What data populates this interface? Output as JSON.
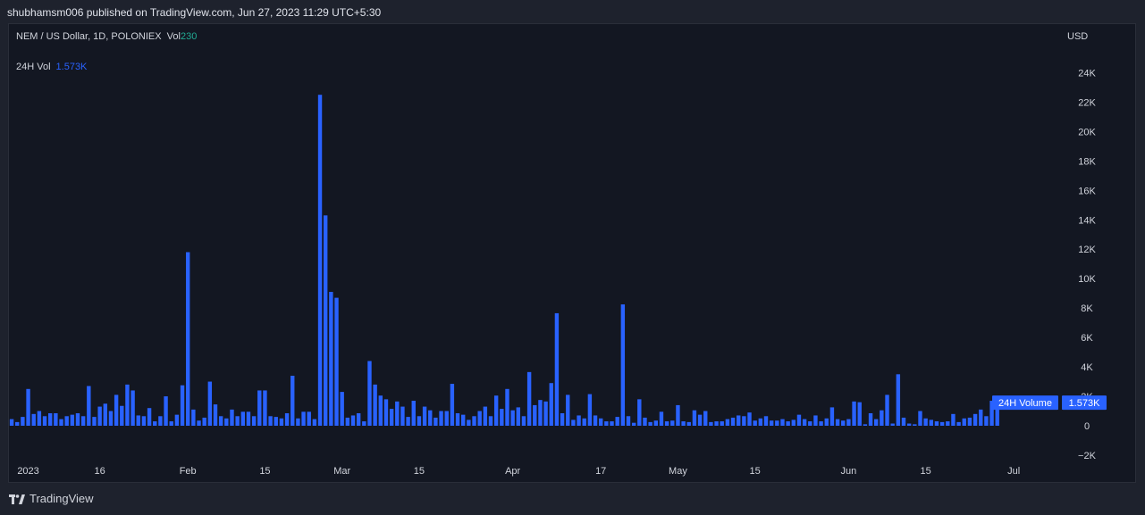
{
  "header": {
    "publish_line": "shubhamsm006 published on TradingView.com, Jun 27, 2023 11:29 UTC+5:30"
  },
  "legend": {
    "symbol": "NEM / US Dollar, 1D, POLONIEX",
    "vol_label": "Vol",
    "vol_value": "230",
    "indicator_label": "24H Vol",
    "indicator_value": "1.573K"
  },
  "currency": "USD",
  "footer": {
    "brand": "TradingView"
  },
  "chart_data": {
    "type": "bar",
    "ylim": [
      -2000,
      25000
    ],
    "yticks": [
      {
        "v": 24000,
        "label": "24K"
      },
      {
        "v": 22000,
        "label": "22K"
      },
      {
        "v": 20000,
        "label": "20K"
      },
      {
        "v": 18000,
        "label": "18K"
      },
      {
        "v": 16000,
        "label": "16K"
      },
      {
        "v": 14000,
        "label": "14K"
      },
      {
        "v": 12000,
        "label": "12K"
      },
      {
        "v": 10000,
        "label": "10K"
      },
      {
        "v": 8000,
        "label": "8K"
      },
      {
        "v": 6000,
        "label": "6K"
      },
      {
        "v": 4000,
        "label": "4K"
      },
      {
        "v": 2000,
        "label": "2K"
      },
      {
        "v": 0,
        "label": "0"
      },
      {
        "v": -2000,
        "label": "−2K"
      }
    ],
    "xticks": [
      {
        "day": 3,
        "label": "2023"
      },
      {
        "day": 16,
        "label": "16"
      },
      {
        "day": 32,
        "label": "Feb"
      },
      {
        "day": 46,
        "label": "15"
      },
      {
        "day": 60,
        "label": "Mar"
      },
      {
        "day": 74,
        "label": "15"
      },
      {
        "day": 91,
        "label": "Apr"
      },
      {
        "day": 107,
        "label": "17"
      },
      {
        "day": 121,
        "label": "May"
      },
      {
        "day": 135,
        "label": "15"
      },
      {
        "day": 152,
        "label": "Jun"
      },
      {
        "day": 166,
        "label": "15"
      },
      {
        "day": 182,
        "label": "Jul"
      }
    ],
    "series": [
      {
        "color": "#2962ff",
        "values": [
          450,
          250,
          600,
          2500,
          800,
          1000,
          650,
          850,
          850,
          450,
          650,
          750,
          850,
          650,
          2700,
          600,
          1300,
          1500,
          1000,
          2100,
          1350,
          2800,
          2400,
          700,
          650,
          1200,
          300,
          650,
          2000,
          300,
          750,
          2750,
          11800,
          1100,
          350,
          550,
          3000,
          1450,
          650,
          500,
          1100,
          650,
          950,
          950,
          650,
          2400,
          2400,
          650,
          600,
          500,
          850,
          3400,
          500,
          950,
          950,
          450,
          22500,
          14300,
          9100,
          8700,
          2300,
          550,
          700,
          850,
          300,
          4400,
          2800,
          2050,
          1800,
          1150,
          1650,
          1300,
          600,
          1700,
          650,
          1300,
          1050,
          550,
          1000,
          1000,
          2850,
          850,
          750,
          400,
          650,
          1000,
          1300,
          650,
          2050,
          1150,
          2500,
          1050,
          1250,
          650,
          3650,
          1400,
          1750,
          1650,
          2900,
          7650,
          850,
          2100,
          400,
          700,
          500,
          2150,
          700,
          500,
          300,
          300,
          600,
          8250,
          650,
          200,
          1800,
          550,
          250,
          350,
          950,
          300,
          350,
          1400,
          300,
          250,
          1050,
          750,
          1000,
          250,
          300,
          300,
          450,
          550,
          700,
          650,
          900,
          350,
          500,
          650,
          350,
          350,
          450,
          300,
          400,
          750,
          450,
          300,
          700,
          300,
          500,
          1250,
          450,
          350,
          450,
          1650,
          1600,
          100,
          850,
          450,
          1050,
          2100,
          150,
          3500,
          550,
          150,
          100,
          1000,
          500,
          400,
          300,
          250,
          300,
          800,
          250,
          500,
          550,
          800,
          1100,
          650,
          1700,
          1573
        ]
      }
    ]
  }
}
